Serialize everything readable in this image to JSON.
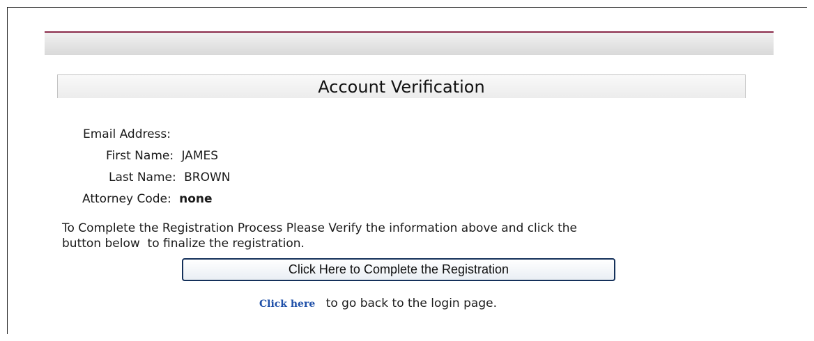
{
  "page": {
    "title": "Account Verification"
  },
  "fields": {
    "email": {
      "label": "Email Address:",
      "value": ""
    },
    "first_name": {
      "label": "First Name:",
      "value": "JAMES"
    },
    "last_name": {
      "label": "Last Name:",
      "value": "BROWN"
    },
    "attorney_code": {
      "label": "Attorney Code:",
      "value": "none"
    }
  },
  "instructions": {
    "line1": "To Complete the Registration Process Please Verify the information above and click the",
    "line2": "button below  to finalize the registration."
  },
  "actions": {
    "complete_button": "Click Here to Complete the Registration",
    "back_link": "Click here",
    "back_text": "to go back to the login page."
  },
  "colors": {
    "accent_line": "#8a2a4a",
    "link": "#1e4fa8",
    "button_border": "#14305a"
  }
}
